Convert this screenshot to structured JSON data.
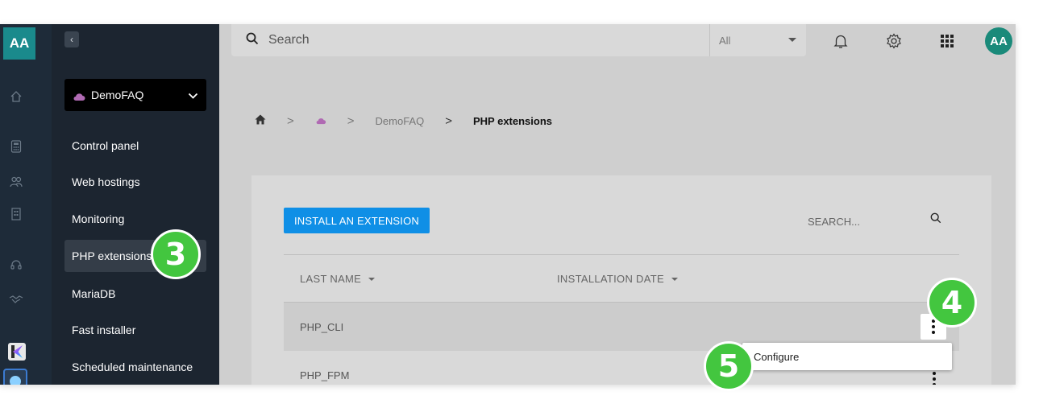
{
  "rail": {
    "avatar_initials": "AA",
    "icons": [
      "home-icon",
      "calculator-icon",
      "users-icon",
      "building-icon",
      "support-icon",
      "handshake-icon"
    ]
  },
  "sidebar": {
    "collapse_label": "‹",
    "project": "DemoFAQ",
    "items": [
      {
        "label": "Control panel"
      },
      {
        "label": "Web hostings"
      },
      {
        "label": "Monitoring"
      },
      {
        "label": "PHP extensions"
      },
      {
        "label": "MariaDB"
      },
      {
        "label": "Fast installer"
      },
      {
        "label": "Scheduled maintenance"
      }
    ]
  },
  "topbar": {
    "search_placeholder": "Search",
    "scope": "All",
    "avatar_initials": "AA"
  },
  "breadcrumb": {
    "project": "DemoFAQ",
    "current": "PHP extensions"
  },
  "card": {
    "install_label": "INSTALL AN EXTENSION",
    "search_label": "SEARCH...",
    "columns": [
      "LAST NAME",
      "INSTALLATION DATE"
    ],
    "rows": [
      {
        "name": "PHP_CLI"
      },
      {
        "name": "PHP_FPM"
      }
    ]
  },
  "menu": {
    "configure_label": "Configure"
  },
  "steps": [
    "3",
    "4",
    "5"
  ],
  "colors": {
    "accent": "#0f8fe6",
    "step_badge": "#43c63f",
    "avatar": "#1a8a8c",
    "cloud": "#b06ab3"
  }
}
